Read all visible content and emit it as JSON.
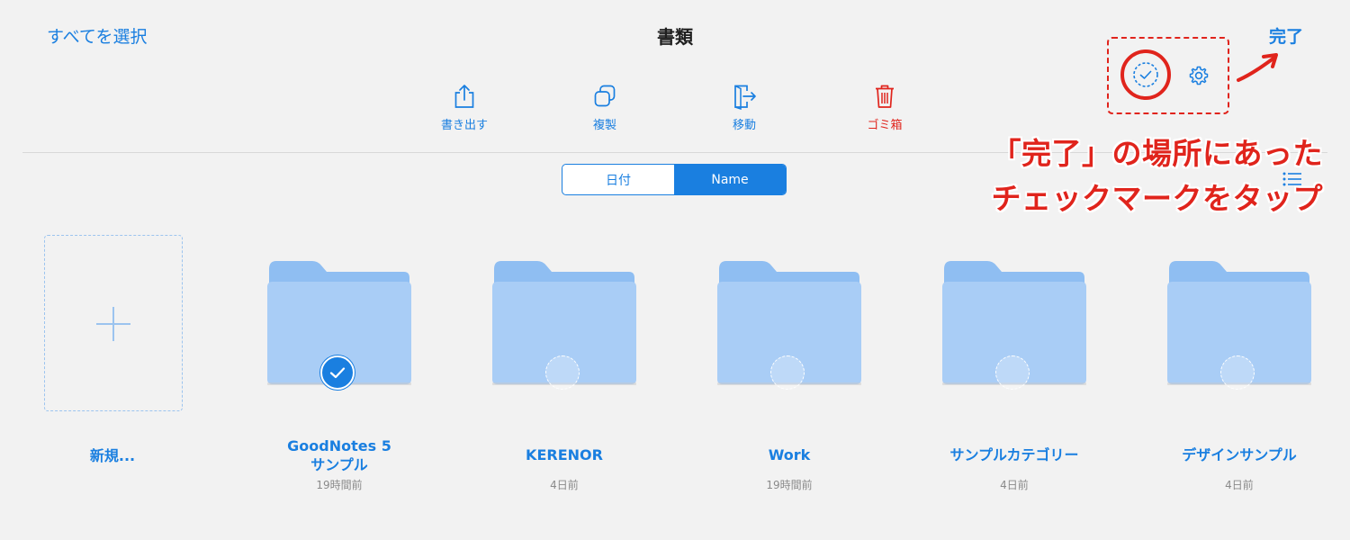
{
  "header": {
    "select_all": "すべてを選択",
    "title": "書類",
    "done": "完了"
  },
  "toolbar": [
    {
      "label": "書き出す",
      "icon": "share-icon"
    },
    {
      "label": "複製",
      "icon": "duplicate-icon"
    },
    {
      "label": "移動",
      "icon": "move-icon"
    },
    {
      "label": "ゴミ箱",
      "icon": "trash-icon"
    }
  ],
  "sort": {
    "options": [
      "日付",
      "Name"
    ],
    "selected": "Name"
  },
  "annotation": {
    "line1": "「完了」の場所にあった",
    "line2": "チェックマークをタップ"
  },
  "new_item": {
    "label": "新規..."
  },
  "folders": [
    {
      "name_line1": "GoodNotes 5",
      "name_line2": "サンプル",
      "date": "19時間前",
      "selected": true
    },
    {
      "name_line1": "KERENOR",
      "name_line2": "",
      "date": "4日前",
      "selected": false
    },
    {
      "name_line1": "Work",
      "name_line2": "",
      "date": "19時間前",
      "selected": false
    },
    {
      "name_line1": "サンプルカテゴリー",
      "name_line2": "",
      "date": "4日前",
      "selected": false
    },
    {
      "name_line1": "デザインサンプル",
      "name_line2": "",
      "date": "4日前",
      "selected": false
    }
  ],
  "colors": {
    "accent": "#1a7fe0",
    "danger": "#e0241c",
    "folder": "#a9cdf6",
    "background": "#f2f2f2"
  }
}
